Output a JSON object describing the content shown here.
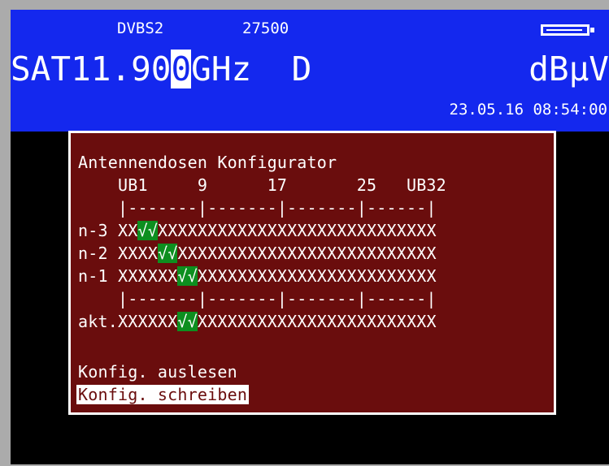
{
  "header": {
    "standard": "DVBS2",
    "symbol_rate": "27500",
    "band": "SAT",
    "freq_before_cursor": "11.90",
    "freq_cursor_digit": "0",
    "freq_unit": "GHz",
    "polarization": "D",
    "level_unit": "dBµV",
    "datetime": "23.05.16 08:54:00",
    "battery_icon": "battery-icon"
  },
  "dialog": {
    "title": "Antennendosen Konfigurator",
    "axis_labels": "    UB1     9      17       25   UB32",
    "scale": "    |-------|-------|-------|------|",
    "rows": [
      {
        "label": "n-3",
        "prefix": " XX",
        "ok": "√√",
        "suffix": "XXXXXXXXXXXXXXXXXXXXXXXXXXXX"
      },
      {
        "label": "n-2",
        "prefix": " XXXX",
        "ok": "√√",
        "suffix": "XXXXXXXXXXXXXXXXXXXXXXXXXX"
      },
      {
        "label": "n-1",
        "prefix": " XXXXXX",
        "ok": "√√",
        "suffix": "XXXXXXXXXXXXXXXXXXXXXXXX"
      }
    ],
    "scale2": "    |-------|-------|-------|------|",
    "current": {
      "label": "akt.",
      "prefix": "XXXXXX",
      "ok": "√√",
      "suffix": "XXXXXXXXXXXXXXXXXXXXXXXX"
    },
    "menu": {
      "read_label": "Konfig. auslesen",
      "write_label": "Konfig. schreiben"
    }
  },
  "colors": {
    "header_bg": "#1428ee",
    "dialog_bg": "#6a0d0d",
    "ok_bg": "#0d8f1f"
  }
}
